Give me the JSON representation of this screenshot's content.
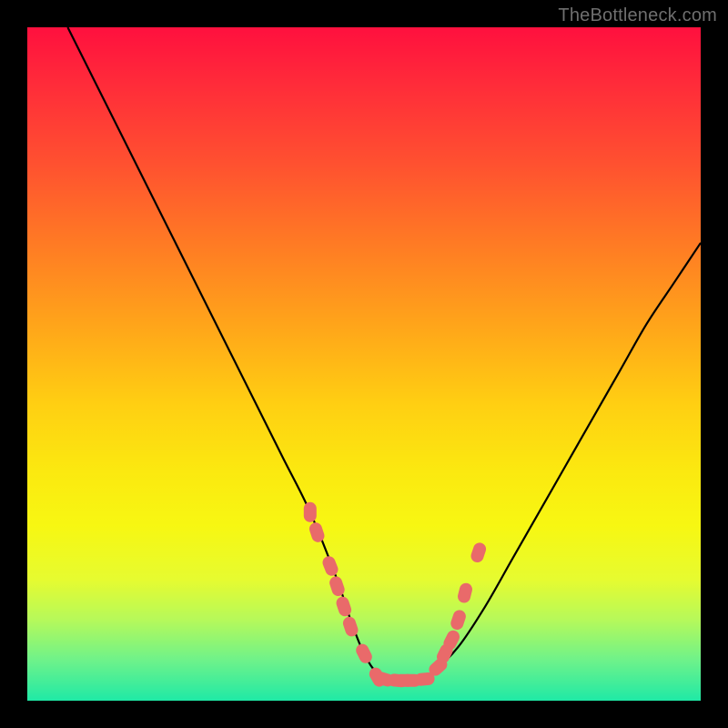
{
  "watermark": "TheBottleneck.com",
  "chart_data": {
    "type": "line",
    "title": "",
    "xlabel": "",
    "ylabel": "",
    "xlim": [
      0,
      100
    ],
    "ylim": [
      0,
      100
    ],
    "grid": false,
    "legend": false,
    "series": [
      {
        "name": "bottleneck-curve",
        "color": "#000000",
        "x": [
          6,
          10,
          14,
          18,
          22,
          26,
          30,
          34,
          38,
          42,
          46,
          48,
          50,
          52,
          54,
          56,
          58,
          60,
          64,
          68,
          72,
          76,
          80,
          84,
          88,
          92,
          96,
          100
        ],
        "values": [
          100,
          92,
          84,
          76,
          68,
          60,
          52,
          44,
          36,
          28,
          18,
          12,
          7,
          4,
          3,
          3,
          3,
          4,
          8,
          14,
          21,
          28,
          35,
          42,
          49,
          56,
          62,
          68
        ]
      },
      {
        "name": "optimum-markers",
        "color": "#e96a6a",
        "type": "scatter",
        "x": [
          42,
          43,
          45,
          46,
          47,
          48,
          50,
          52,
          53,
          55,
          56,
          57,
          59,
          61,
          62,
          63,
          64,
          65,
          67
        ],
        "values": [
          28,
          25,
          20,
          17,
          14,
          11,
          7,
          3.5,
          3.2,
          3,
          3,
          3,
          3.2,
          5,
          7,
          9,
          12,
          16,
          22
        ]
      }
    ],
    "annotations": []
  },
  "colors": {
    "background": "#000000",
    "curve": "#000000",
    "marker": "#e96a6a",
    "gradient_top": "#ff103e",
    "gradient_bottom": "#1fe9a6"
  }
}
